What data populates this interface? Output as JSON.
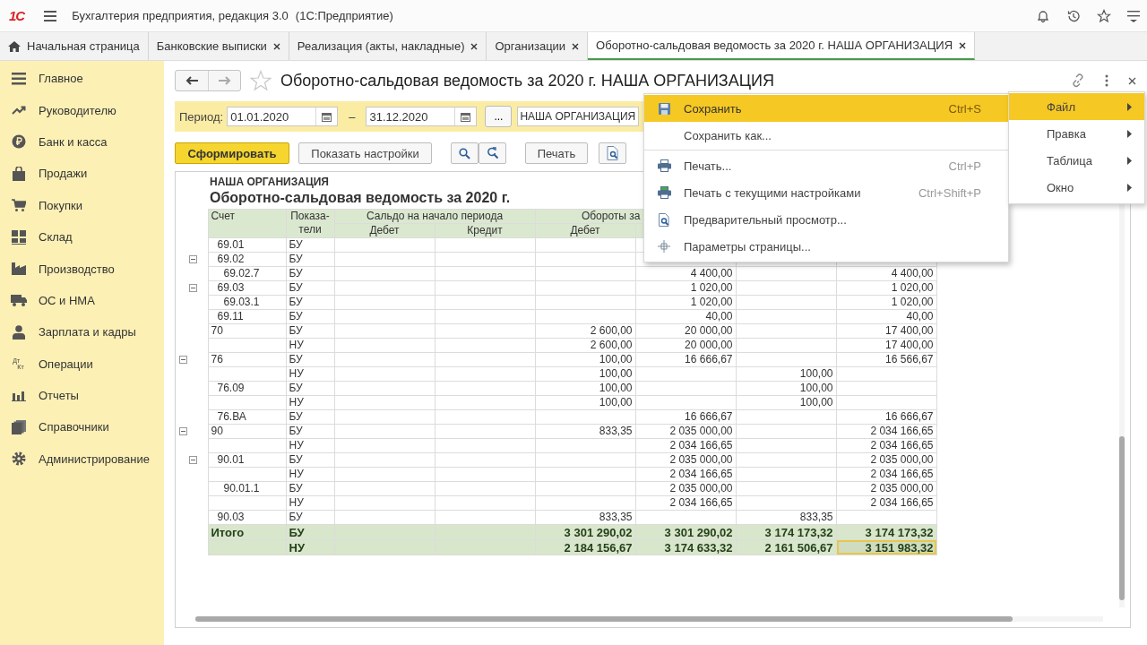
{
  "app": {
    "logo": "1С",
    "title": "Бухгалтерия предприятия, редакция 3.0",
    "platform": "(1С:Предприятие)"
  },
  "tabs": [
    {
      "label": "Начальная страница",
      "selected": false,
      "kind": "home"
    },
    {
      "label": "Банковские выписки",
      "selected": false,
      "kind": "closable"
    },
    {
      "label": "Реализация (акты, накладные)",
      "selected": false,
      "kind": "closable"
    },
    {
      "label": "Организации",
      "selected": false,
      "kind": "closable"
    },
    {
      "label": "Оборотно-сальдовая ведомость за 2020 г. НАША ОРГАНИЗАЦИЯ",
      "selected": true,
      "kind": "closable"
    }
  ],
  "sidebar": {
    "items": [
      {
        "label": "Главное"
      },
      {
        "label": "Руководителю"
      },
      {
        "label": "Банк и касса"
      },
      {
        "label": "Продажи"
      },
      {
        "label": "Покупки"
      },
      {
        "label": "Склад"
      },
      {
        "label": "Производство"
      },
      {
        "label": "ОС и НМА"
      },
      {
        "label": "Зарплата и кадры"
      },
      {
        "label": "Операции",
        "icon_text": [
          "Дт",
          "Кт"
        ]
      },
      {
        "label": "Отчеты"
      },
      {
        "label": "Справочники"
      },
      {
        "label": "Администрирование"
      }
    ]
  },
  "form": {
    "title": "Оборотно-сальдовая ведомость за 2020 г. НАША ОРГАНИЗАЦИЯ",
    "favorite": false,
    "period": {
      "label": "Период:",
      "from": "01.01.2020",
      "separator": "–",
      "to": "31.12.2020",
      "more": "...",
      "organization": "НАША ОРГАНИЗАЦИЯ"
    },
    "buttons": {
      "generate": "Сформировать",
      "settings": "Показать настройки",
      "print": "Печать"
    }
  },
  "report": {
    "organization": "НАША ОРГАНИЗАЦИЯ",
    "title": "Оборотно-сальдовая ведомость за 2020 г.",
    "columns": {
      "account": "Счет",
      "indicator": "Показа-тели",
      "groups": [
        {
          "label": "Сальдо на начало периода",
          "sub": [
            "Дебет",
            "Кредит"
          ]
        },
        {
          "label": "Обороты за",
          "sub": [
            "Дебет"
          ]
        }
      ]
    },
    "rows": [
      {
        "children": [
          {
            "account": "69.01",
            "lines": [
              {
                "indicator": "БУ",
                "cells": [
                  null,
                  null,
                  null,
                  null,
                  null,
                  null
                ]
              }
            ]
          },
          {
            "account": "69.02",
            "expanded": true,
            "lines": [
              {
                "indicator": "БУ",
                "cells": [
                  null,
                  null,
                  null,
                  null,
                  null,
                  null
                ]
              }
            ],
            "children": [
              {
                "account": "69.02.7",
                "lines": [
                  {
                    "indicator": "БУ",
                    "cells": [
                      null,
                      null,
                      null,
                      "4 400,00",
                      null,
                      "4 400,00"
                    ]
                  }
                ]
              }
            ]
          },
          {
            "account": "69.03",
            "expanded": true,
            "lines": [
              {
                "indicator": "БУ",
                "cells": [
                  null,
                  null,
                  null,
                  "1 020,00",
                  null,
                  "1 020,00"
                ]
              }
            ],
            "children": [
              {
                "account": "69.03.1",
                "lines": [
                  {
                    "indicator": "БУ",
                    "cells": [
                      null,
                      null,
                      null,
                      "1 020,00",
                      null,
                      "1 020,00"
                    ]
                  }
                ]
              }
            ]
          },
          {
            "account": "69.11",
            "lines": [
              {
                "indicator": "БУ",
                "cells": [
                  null,
                  null,
                  null,
                  "40,00",
                  null,
                  "40,00"
                ]
              }
            ]
          }
        ]
      },
      {
        "account": "70",
        "lines": [
          {
            "indicator": "БУ",
            "cells": [
              null,
              null,
              "2 600,00",
              "20 000,00",
              null,
              "17 400,00"
            ]
          },
          {
            "indicator": "НУ",
            "cells": [
              null,
              null,
              "2 600,00",
              "20 000,00",
              null,
              "17 400,00"
            ]
          }
        ]
      },
      {
        "account": "76",
        "expanded": true,
        "lines": [
          {
            "indicator": "БУ",
            "cells": [
              null,
              null,
              "100,00",
              "16 666,67",
              null,
              "16 566,67"
            ]
          },
          {
            "indicator": "НУ",
            "cells": [
              null,
              null,
              "100,00",
              null,
              "100,00",
              null
            ]
          }
        ],
        "children": [
          {
            "account": "76.09",
            "lines": [
              {
                "indicator": "БУ",
                "cells": [
                  null,
                  null,
                  "100,00",
                  null,
                  "100,00",
                  null
                ]
              },
              {
                "indicator": "НУ",
                "cells": [
                  null,
                  null,
                  "100,00",
                  null,
                  "100,00",
                  null
                ]
              }
            ]
          },
          {
            "account": "76.ВА",
            "lines": [
              {
                "indicator": "БУ",
                "cells": [
                  null,
                  null,
                  null,
                  "16 666,67",
                  null,
                  "16 666,67"
                ]
              }
            ]
          }
        ]
      },
      {
        "account": "90",
        "expanded": true,
        "lines": [
          {
            "indicator": "БУ",
            "cells": [
              null,
              null,
              "833,35",
              "2 035 000,00",
              null,
              "2 034 166,65"
            ]
          },
          {
            "indicator": "НУ",
            "cells": [
              null,
              null,
              null,
              "2 034 166,65",
              null,
              "2 034 166,65"
            ]
          }
        ],
        "children": [
          {
            "account": "90.01",
            "expanded": true,
            "lines": [
              {
                "indicator": "БУ",
                "cells": [
                  null,
                  null,
                  null,
                  "2 035 000,00",
                  null,
                  "2 035 000,00"
                ]
              },
              {
                "indicator": "НУ",
                "cells": [
                  null,
                  null,
                  null,
                  "2 034 166,65",
                  null,
                  "2 034 166,65"
                ]
              }
            ],
            "children": [
              {
                "account": "90.01.1",
                "lines": [
                  {
                    "indicator": "БУ",
                    "cells": [
                      null,
                      null,
                      null,
                      "2 035 000,00",
                      null,
                      "2 035 000,00"
                    ]
                  },
                  {
                    "indicator": "НУ",
                    "cells": [
                      null,
                      null,
                      null,
                      "2 034 166,65",
                      null,
                      "2 034 166,65"
                    ]
                  }
                ]
              }
            ]
          },
          {
            "account": "90.03",
            "lines": [
              {
                "indicator": "БУ",
                "cells": [
                  null,
                  null,
                  "833,35",
                  null,
                  "833,35",
                  null
                ]
              }
            ]
          }
        ]
      }
    ],
    "total": {
      "label": "Итого",
      "lines": [
        {
          "indicator": "БУ",
          "cells": [
            {
              "text": null,
              "selected": false
            },
            {
              "text": null,
              "selected": false
            },
            {
              "text": "3 301 290,02",
              "selected": false
            },
            {
              "text": "3 301 290,02",
              "selected": false
            },
            {
              "text": "3 174 173,32",
              "selected": false
            },
            {
              "text": "3 174 173,32",
              "selected": false
            }
          ]
        },
        {
          "indicator": "НУ",
          "cells": [
            {
              "text": null,
              "selected": false
            },
            {
              "text": null,
              "selected": false
            },
            {
              "text": "2 184 156,67",
              "selected": false
            },
            {
              "text": "3 174 633,32",
              "selected": false
            },
            {
              "text": "2 161 506,67",
              "selected": false
            },
            {
              "text": "3 151 983,32",
              "selected": true
            }
          ]
        }
      ]
    }
  },
  "menu": {
    "items": [
      {
        "label": "Файл",
        "selected": true
      },
      {
        "label": "Правка",
        "selected": false
      },
      {
        "label": "Таблица",
        "selected": false
      },
      {
        "label": "Окно",
        "selected": false
      }
    ],
    "submenu": {
      "groups": [
        [
          {
            "label": "Сохранить",
            "shortcut": "Ctrl+S",
            "selected": true
          },
          {
            "label": "Сохранить как...",
            "selected": false
          }
        ],
        [
          {
            "label": "Печать...",
            "shortcut": "Ctrl+P",
            "selected": false
          },
          {
            "label": "Печать с текущими настройками",
            "shortcut": "Ctrl+Shift+P",
            "selected": false
          },
          {
            "label": "Предварительный просмотр...",
            "selected": false
          },
          {
            "label": "Параметры страницы...",
            "selected": false
          }
        ]
      ]
    }
  }
}
